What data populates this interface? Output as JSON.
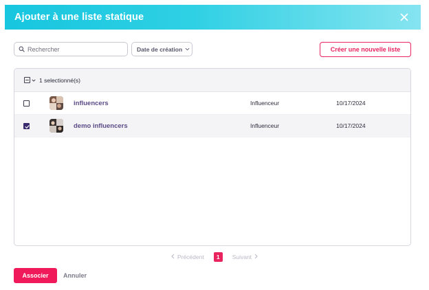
{
  "modal": {
    "title": "Ajouter à une liste statique",
    "close_icon": "close-icon"
  },
  "toolbar": {
    "search_placeholder": "Rechercher",
    "search_value": "",
    "sort_label": "Date de création",
    "create_label": "Créer une nouvelle liste"
  },
  "table": {
    "selected_count_label": "1 selectionné(s)",
    "rows": [
      {
        "name": "influencers",
        "type": "Influenceur",
        "date": "10/17/2024",
        "checked": false
      },
      {
        "name": "demo influencers",
        "type": "Influenceur",
        "date": "10/17/2024",
        "checked": true
      }
    ]
  },
  "pagination": {
    "prev_label": "Précédent",
    "current_page": "1",
    "next_label": "Suivant"
  },
  "footer": {
    "associate_label": "Associer",
    "cancel_label": "Annuler"
  },
  "colors": {
    "accent": "#e8235e",
    "header_gradient_start": "#17c6df",
    "header_gradient_end": "#86e4f0",
    "link_purple": "#5b4a86"
  }
}
